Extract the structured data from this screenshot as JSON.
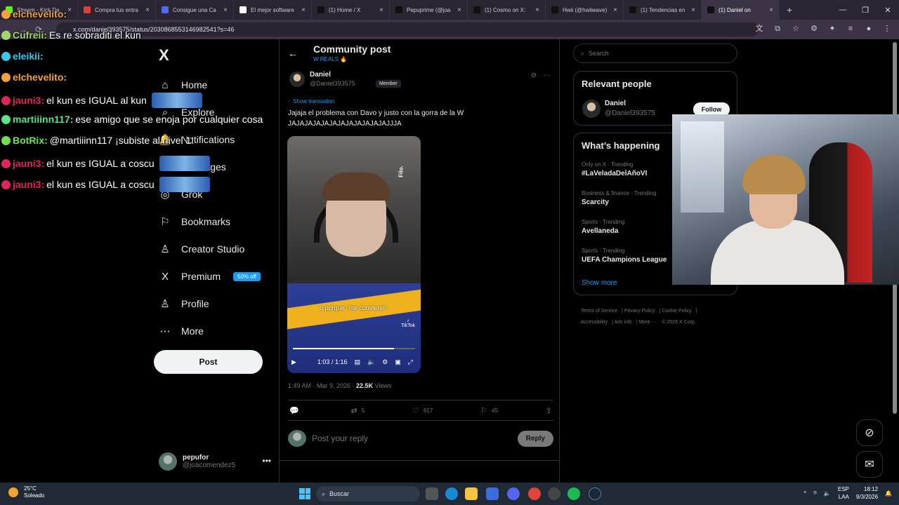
{
  "browser": {
    "tabs": [
      {
        "label": "Stream - Kick Da",
        "color": "#53fc18"
      },
      {
        "label": "Compra tus entra",
        "color": "#e23b3b"
      },
      {
        "label": "Consigue una Ca",
        "color": "#4c6ef5"
      },
      {
        "label": "El mejor software",
        "color": "#ffffff"
      },
      {
        "label": "(1) Home / X",
        "color": "#111111"
      },
      {
        "label": "Pepuprime (@joa",
        "color": "#111111"
      },
      {
        "label": "(1) Cosmo on X: ",
        "color": "#111111"
      },
      {
        "label": "Hwii (@hwiiwave)",
        "color": "#111111"
      },
      {
        "label": "(1) Tendencias en",
        "color": "#111111"
      },
      {
        "label": "(1) Daniel on",
        "color": "#111111"
      }
    ],
    "new_tab": "+",
    "url": "x.com/daniel393575/status/2030868553146982541?s=46",
    "window_controls": [
      "—",
      "❐",
      "✕"
    ]
  },
  "nav": {
    "logo": "X",
    "items": [
      {
        "label": "Home",
        "icon": "⌂"
      },
      {
        "label": "Explore",
        "icon": "⌕"
      },
      {
        "label": "Notifications",
        "icon": "🔔"
      },
      {
        "label": "Messages",
        "icon": "✉"
      },
      {
        "label": "Grok",
        "icon": "◎"
      },
      {
        "label": "Bookmarks",
        "icon": "⚐"
      },
      {
        "label": "Creator Studio",
        "icon": "♙"
      },
      {
        "label": "Premium",
        "icon": "X"
      },
      {
        "label": "Profile",
        "icon": "♙"
      },
      {
        "label": "More",
        "icon": "⋯"
      }
    ],
    "premium_badge": "50% off",
    "post_button": "Post",
    "account": {
      "name": "pepufor",
      "handle": "@joacomendez5"
    }
  },
  "post": {
    "header_title": "Community post",
    "community": "W REALS 🔥",
    "author_name": "Daniel",
    "author_handle": "@Daniel393575",
    "member_badge": "Member",
    "show_translation": "Show translation",
    "text": "Jajaja el problema con Davo y justo con la gorra de la W JAJAJAJAJAJAJAJAJAJAJAJAJJJA",
    "video": {
      "caption": "o porque \"me conviene\".",
      "watermark": "Filo.",
      "platform": "TikTok",
      "time": "1:03 / 1:16",
      "progress": 0.83
    },
    "timestamp": "1:49 AM · Mar 9, 2026 · ",
    "views_count": "22.5K",
    "views_label": " Views",
    "stats": {
      "replies": "",
      "reposts": "5",
      "likes": "617",
      "bookmarks": "45"
    },
    "reply_placeholder": "Post your reply",
    "reply_button": "Reply"
  },
  "sidebar": {
    "search_placeholder": "Search",
    "relevant_title": "Relevant people",
    "person": {
      "name": "Daniel",
      "handle": "@Daniel393575",
      "follow": "Follow"
    },
    "happening_title": "What’s happening",
    "trends": [
      {
        "meta": "Only on X · Trending",
        "name": "#LaVeladaDelAñoVI"
      },
      {
        "meta": "Business & finance · Trending",
        "name": "Scarcity"
      },
      {
        "meta": "Sports · Trending",
        "name": "Avellaneda"
      },
      {
        "meta": "Sports · Trending",
        "name": "UEFA Champions League"
      }
    ],
    "show_more": "Show more",
    "footer": [
      "Terms of Service",
      "Privacy Policy",
      "Cookie Policy",
      "Accessibility",
      "Ads info",
      "More ···",
      "© 2026 X Corp."
    ]
  },
  "chat": [
    {
      "user": "elchevelito:",
      "color": "#f2a33a",
      "msg": ""
    },
    {
      "user": "Cufreii:",
      "color": "#a5d66b",
      "msg": "Es re sobraditi el kun"
    },
    {
      "user": "eleikii:",
      "color": "#36c9e8",
      "msg": ""
    },
    {
      "user": "elchevelito:",
      "color": "#f2a33a",
      "msg": ""
    },
    {
      "user": "jauni3:",
      "color": "#e0245e",
      "msg": "el kun es IGUAL al kun"
    },
    {
      "user": "martiiinn117:",
      "color": "#59e38a",
      "msg": "ese amigo que se enoja por cualquier cosa"
    },
    {
      "user": "BotRix:",
      "color": "#6ee24d",
      "msg": "@martiiinn117 ¡subiste al nivel 1!"
    },
    {
      "user": "jauni3:",
      "color": "#e0245e",
      "msg": "el kun es IGUAL a coscu"
    },
    {
      "user": "jauni3:",
      "color": "#e0245e",
      "msg": "el kun es IGUAL a coscu"
    }
  ],
  "taskbar": {
    "temperature": "25°C",
    "weather": "Soleado",
    "search": "Buscar",
    "lang": "ESP",
    "lang2": "LAA",
    "time": "18:12",
    "date": "9/3/2026"
  }
}
